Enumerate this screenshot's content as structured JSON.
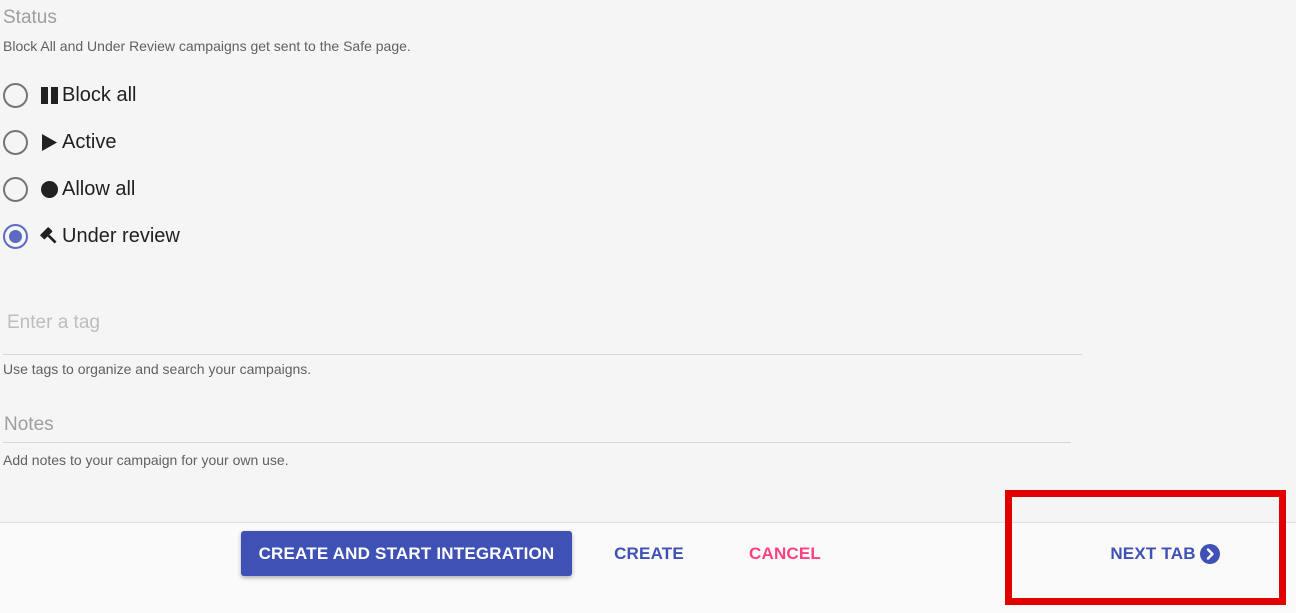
{
  "status": {
    "heading": "Status",
    "hint": "Block All and Under Review campaigns get sent to the Safe page.",
    "options": [
      {
        "label": "Block all",
        "icon": "pause-icon",
        "checked": false
      },
      {
        "label": "Active",
        "icon": "play-icon",
        "checked": false
      },
      {
        "label": "Allow all",
        "icon": "circle-icon",
        "checked": false
      },
      {
        "label": "Under review",
        "icon": "gavel-icon",
        "checked": true
      }
    ]
  },
  "tags": {
    "placeholder": "Enter a tag",
    "value": "",
    "hint": "Use tags to organize and search your campaigns."
  },
  "notes": {
    "placeholder": "Notes",
    "value": "",
    "hint": "Add notes to your campaign for your own use."
  },
  "footer": {
    "create_and_start_label": "CREATE AND START INTEGRATION",
    "create_label": "CREATE",
    "cancel_label": "CANCEL",
    "next_tab_label": "NEXT TAB",
    "next_tab_icon": "chevron-right-circle-icon"
  },
  "colors": {
    "primary": "#3f51b5",
    "accent": "#ff4081",
    "radio_checked": "#5c6bc0",
    "highlight": "#e00000"
  }
}
